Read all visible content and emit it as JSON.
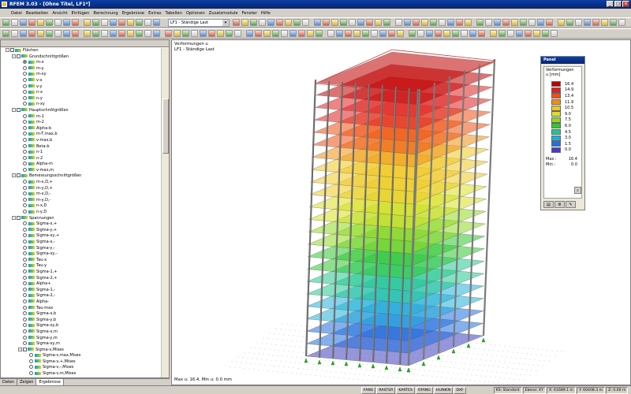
{
  "window": {
    "title": "RFEM 3.03 - [Ohne Titel, LF1*]"
  },
  "menu": [
    "Datei",
    "Bearbeiten",
    "Ansicht",
    "Einfügen",
    "Berechnung",
    "Ergebnisse",
    "Extras",
    "Tabellen",
    "Optionen",
    "Zusatzmodule",
    "Fenster",
    "Hilfe"
  ],
  "toolbar": {
    "loadcase": "LF1 - Ständige Last"
  },
  "tree": [
    {
      "level": 0,
      "expand": "-",
      "check": true,
      "icon": true,
      "label": "Flächen"
    },
    {
      "level": 1,
      "expand": "-",
      "check": true,
      "icon": true,
      "label": "Grundschnittgrößen"
    },
    {
      "level": 2,
      "radio": true,
      "selected": true,
      "icon": true,
      "label": "m-x"
    },
    {
      "level": 2,
      "radio": true,
      "icon": true,
      "label": "m-y"
    },
    {
      "level": 2,
      "radio": true,
      "icon": true,
      "label": "m-xy"
    },
    {
      "level": 2,
      "radio": true,
      "icon": true,
      "label": "v-x"
    },
    {
      "level": 2,
      "radio": true,
      "icon": true,
      "label": "v-y"
    },
    {
      "level": 2,
      "radio": true,
      "icon": true,
      "label": "n-x"
    },
    {
      "level": 2,
      "radio": true,
      "icon": true,
      "label": "n-y"
    },
    {
      "level": 2,
      "radio": true,
      "icon": true,
      "label": "n-xy"
    },
    {
      "level": 1,
      "expand": "-",
      "check": true,
      "icon": true,
      "label": "Hauptschnittgrößen"
    },
    {
      "level": 2,
      "radio": true,
      "icon": true,
      "label": "m-1"
    },
    {
      "level": 2,
      "radio": true,
      "icon": true,
      "label": "m-2"
    },
    {
      "level": 2,
      "radio": true,
      "icon": true,
      "label": "Alpha-b"
    },
    {
      "level": 2,
      "radio": true,
      "icon": true,
      "label": "m-T,max,b"
    },
    {
      "level": 2,
      "radio": true,
      "icon": true,
      "label": "v-max,b"
    },
    {
      "level": 2,
      "radio": true,
      "icon": true,
      "label": "Beta-b"
    },
    {
      "level": 2,
      "radio": true,
      "icon": true,
      "label": "n-1"
    },
    {
      "level": 2,
      "radio": true,
      "icon": true,
      "label": "n-2"
    },
    {
      "level": 2,
      "radio": true,
      "icon": true,
      "label": "Alpha-m"
    },
    {
      "level": 2,
      "radio": true,
      "icon": true,
      "label": "v-max,m"
    },
    {
      "level": 1,
      "expand": "-",
      "check": true,
      "icon": true,
      "label": "Bemessungsschnittgrößen"
    },
    {
      "level": 2,
      "radio": true,
      "icon": true,
      "label": "m-x,D,+"
    },
    {
      "level": 2,
      "radio": true,
      "icon": true,
      "label": "m-y,D,+"
    },
    {
      "level": 2,
      "radio": true,
      "icon": true,
      "label": "m-x,D,-"
    },
    {
      "level": 2,
      "radio": true,
      "icon": true,
      "label": "m-y,D,-"
    },
    {
      "level": 2,
      "radio": true,
      "icon": true,
      "label": "n-x,D"
    },
    {
      "level": 2,
      "radio": true,
      "icon": true,
      "label": "n-y,D"
    },
    {
      "level": 1,
      "expand": "-",
      "check": true,
      "icon": true,
      "label": "Spannungen"
    },
    {
      "level": 2,
      "radio": true,
      "icon": true,
      "label": "Sigma-x,+"
    },
    {
      "level": 2,
      "radio": true,
      "icon": true,
      "label": "Sigma-y,+"
    },
    {
      "level": 2,
      "radio": true,
      "icon": true,
      "label": "Sigma-xy,+"
    },
    {
      "level": 2,
      "radio": true,
      "icon": true,
      "label": "Sigma-x,-"
    },
    {
      "level": 2,
      "radio": true,
      "icon": true,
      "label": "Sigma-y,-"
    },
    {
      "level": 2,
      "radio": true,
      "icon": true,
      "label": "Sigma-xy,-"
    },
    {
      "level": 2,
      "radio": true,
      "icon": true,
      "label": "Tau-x"
    },
    {
      "level": 2,
      "radio": true,
      "icon": true,
      "label": "Tau-y"
    },
    {
      "level": 2,
      "radio": true,
      "icon": true,
      "label": "Sigma-1,+"
    },
    {
      "level": 2,
      "radio": true,
      "icon": true,
      "label": "Sigma-2,+"
    },
    {
      "level": 2,
      "radio": true,
      "icon": true,
      "label": "Alpha+"
    },
    {
      "level": 2,
      "radio": true,
      "icon": true,
      "label": "Sigma-1,-"
    },
    {
      "level": 2,
      "radio": true,
      "icon": true,
      "label": "Sigma-2,-"
    },
    {
      "level": 2,
      "radio": true,
      "icon": true,
      "label": "Alpha-"
    },
    {
      "level": 2,
      "radio": true,
      "icon": true,
      "label": "Tau-max"
    },
    {
      "level": 2,
      "radio": true,
      "icon": true,
      "label": "Sigma-x,b"
    },
    {
      "level": 2,
      "radio": true,
      "icon": true,
      "label": "Sigma-y,b"
    },
    {
      "level": 2,
      "radio": true,
      "icon": true,
      "label": "Sigma-xy,b"
    },
    {
      "level": 2,
      "radio": true,
      "icon": true,
      "label": "Sigma-x,m"
    },
    {
      "level": 2,
      "radio": true,
      "icon": true,
      "label": "Sigma-y,m"
    },
    {
      "level": 2,
      "radio": true,
      "icon": true,
      "label": "Sigma-xy,m"
    },
    {
      "level": 2,
      "expand": "-",
      "check": true,
      "icon": true,
      "label": "Sigma-v,Mises"
    },
    {
      "level": 3,
      "radio": true,
      "icon": true,
      "label": "Sigma-v,max,Mises"
    },
    {
      "level": 3,
      "radio": true,
      "icon": true,
      "label": "Sigma-v,+,Mises"
    },
    {
      "level": 3,
      "radio": true,
      "icon": true,
      "label": "Sigma-v,-,Mises"
    },
    {
      "level": 3,
      "radio": true,
      "icon": true,
      "label": "Sigma-v,m,Mises"
    }
  ],
  "navtabs": [
    "Daten",
    "Zeigen",
    "Ergebnisse"
  ],
  "view": {
    "title1": "Verformungen u",
    "title2": "LF1 - Ständige Last",
    "footer": "Max u: 16.4, Min u: 0.0 mm"
  },
  "panel": {
    "title": "Panel",
    "heading1": "Verformungen",
    "heading2": "u [mm]",
    "legend": [
      {
        "value": "16.4",
        "color": "#c00000"
      },
      {
        "value": "14.9",
        "color": "#e02020"
      },
      {
        "value": "13.4",
        "color": "#f05010"
      },
      {
        "value": "11.9",
        "color": "#f09010"
      },
      {
        "value": "10.5",
        "color": "#f0c820"
      },
      {
        "value": "9.0",
        "color": "#d8e020"
      },
      {
        "value": "7.5",
        "color": "#90d820"
      },
      {
        "value": "6.0",
        "color": "#30c830"
      },
      {
        "value": "4.5",
        "color": "#20c890"
      },
      {
        "value": "3.0",
        "color": "#20b0d8"
      },
      {
        "value": "1.5",
        "color": "#2070e0"
      },
      {
        "value": "0.0",
        "color": "#4040c0"
      }
    ],
    "max_label": "Max :",
    "max_value": "16.4",
    "min_label": "Min :",
    "min_value": "0.0"
  },
  "status": {
    "buttons": [
      "FANG",
      "RASTER",
      "KARTES",
      "OFANG",
      "HLINIEN",
      "DXF"
    ],
    "ks": "KS: Standard",
    "ebene": "Ebene: XY",
    "x": "X: 61689.1 m",
    "y": "Y: 60408.3 m",
    "z": "Z: 0.00 m"
  }
}
